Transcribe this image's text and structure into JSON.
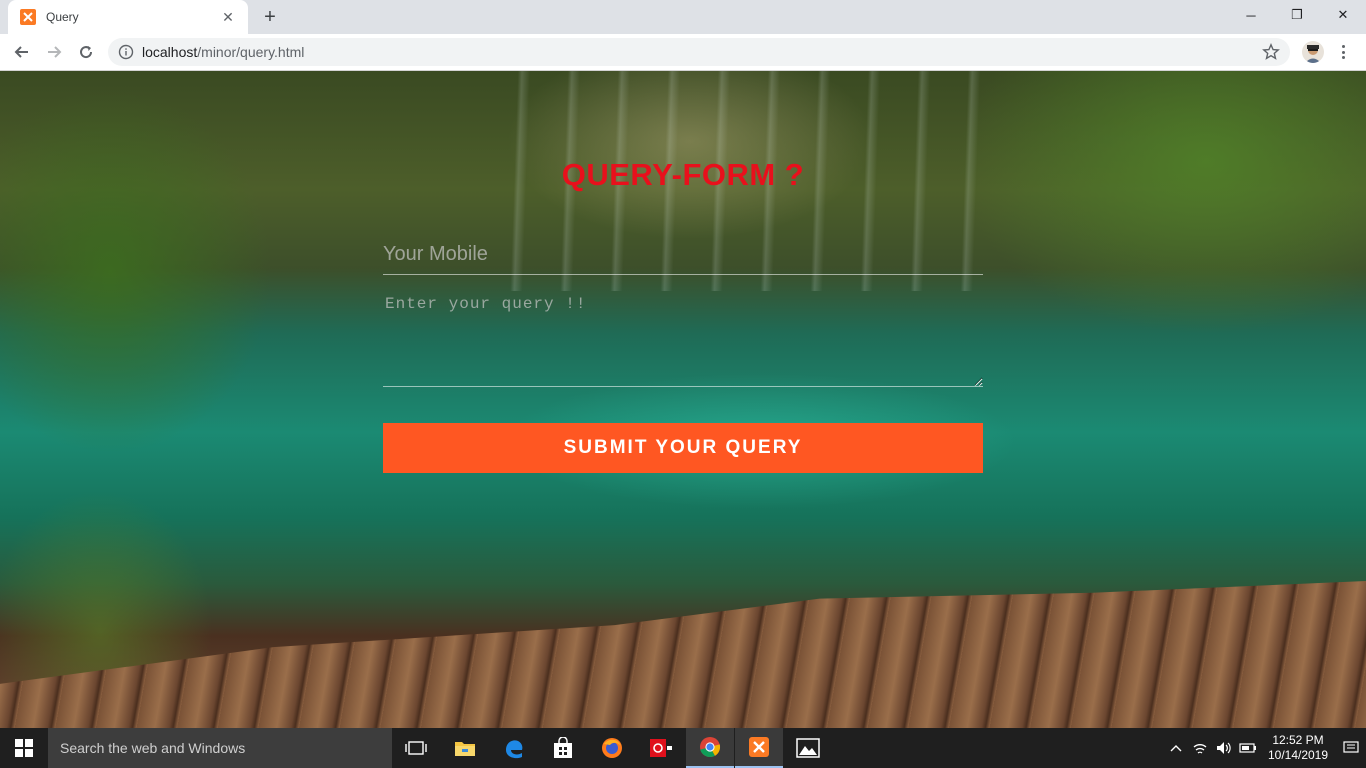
{
  "browser": {
    "tab_title": "Query",
    "new_tab_symbol": "+",
    "close_tab_symbol": "✕",
    "url_host": "localhost",
    "url_path": "/minor/query.html",
    "window_controls": {
      "minimize": "─",
      "restore": "❐",
      "close": "✕"
    }
  },
  "form": {
    "title": "QUERY-FORM ?",
    "mobile_placeholder": "Your Mobile",
    "query_placeholder": "Enter your query !!",
    "submit_label": "SUBMIT YOUR QUERY"
  },
  "taskbar": {
    "search_placeholder": "Search the web and Windows",
    "time": "12:52 PM",
    "date": "10/14/2019"
  },
  "colors": {
    "title": "#e8101c",
    "submit": "#ff5722",
    "favicon": "#fb7a24"
  },
  "icons": [
    "back-icon",
    "forward-icon",
    "reload-icon",
    "info-icon",
    "star-icon",
    "windows-logo-icon",
    "task-view-icon",
    "file-explorer-icon",
    "edge-icon",
    "store-icon",
    "firefox-icon",
    "app-icon",
    "chrome-icon",
    "xampp-icon",
    "photos-icon",
    "chevron-up-icon",
    "network-icon",
    "volume-icon",
    "battery-icon",
    "notification-icon"
  ]
}
